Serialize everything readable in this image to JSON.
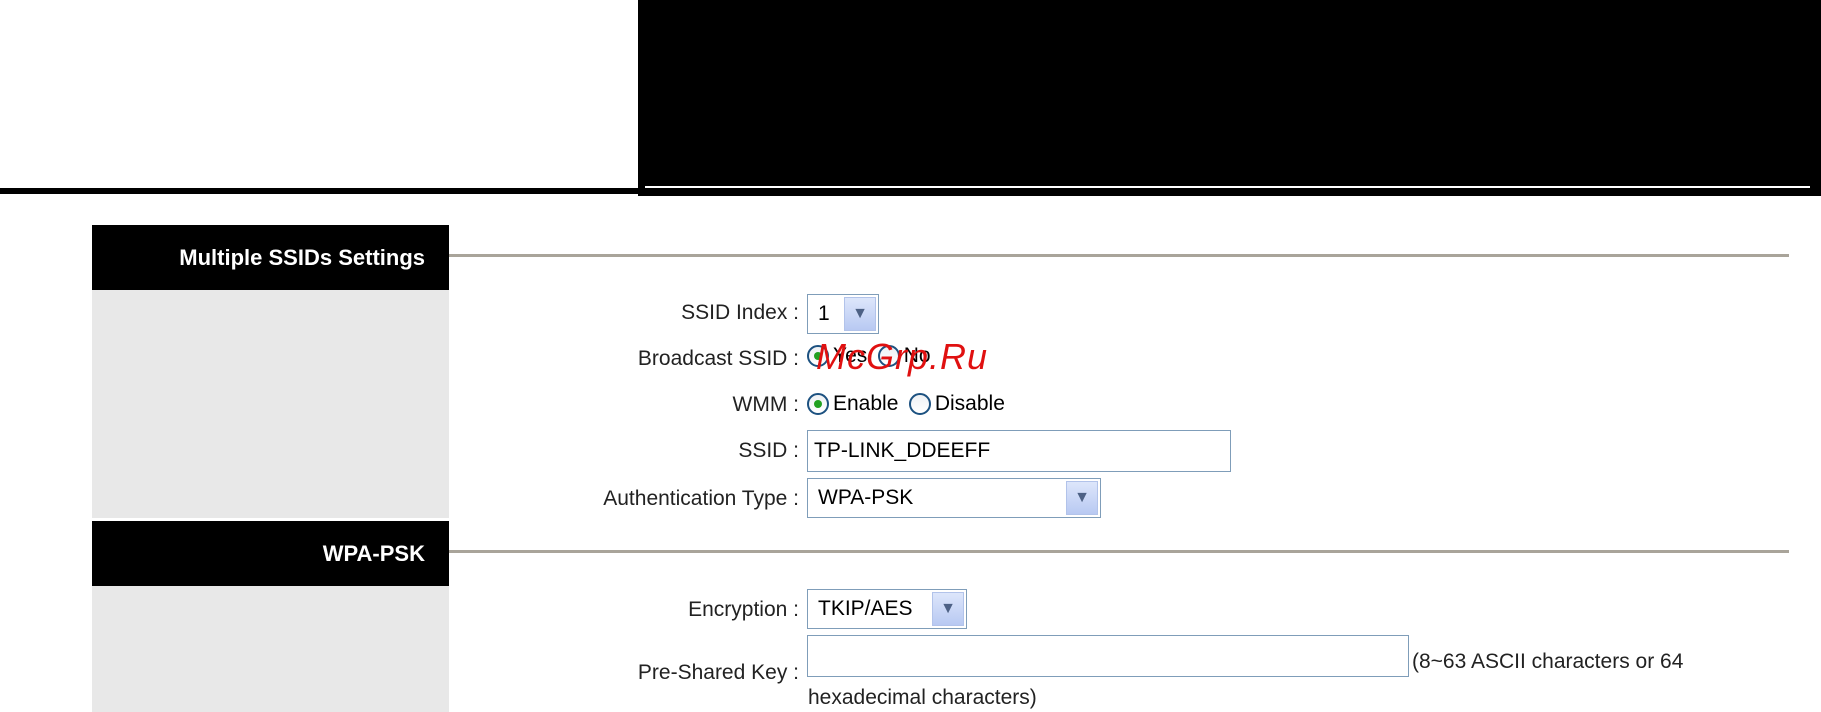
{
  "sections": [
    {
      "title": "Multiple SSIDs Settings"
    },
    {
      "title": "WPA-PSK"
    }
  ],
  "fields": {
    "ssid_index": {
      "label": "SSID Index :",
      "value": "1"
    },
    "broadcast_ssid": {
      "label": "Broadcast SSID :",
      "options": [
        "Yes",
        "No"
      ],
      "selected": "Yes"
    },
    "wmm": {
      "label": "WMM :",
      "options": [
        "Enable",
        "Disable"
      ],
      "selected": "Enable"
    },
    "ssid": {
      "label": "SSID :",
      "value": "TP-LINK_DDEEFF"
    },
    "auth_type": {
      "label": "Authentication Type :",
      "value": "WPA-PSK"
    },
    "encryption": {
      "label": "Encryption :",
      "value": "TKIP/AES"
    },
    "psk": {
      "label": "Pre-Shared Key :",
      "value": "",
      "hint_line1": "(8~63 ASCII characters or 64",
      "hint_line2": "hexadecimal characters)"
    }
  },
  "watermark": "McGrp.Ru",
  "colors": {
    "header": "#000000",
    "rule": "#a9a49a",
    "sidebar": "#e8e8e8",
    "watermark": "#e01010"
  }
}
